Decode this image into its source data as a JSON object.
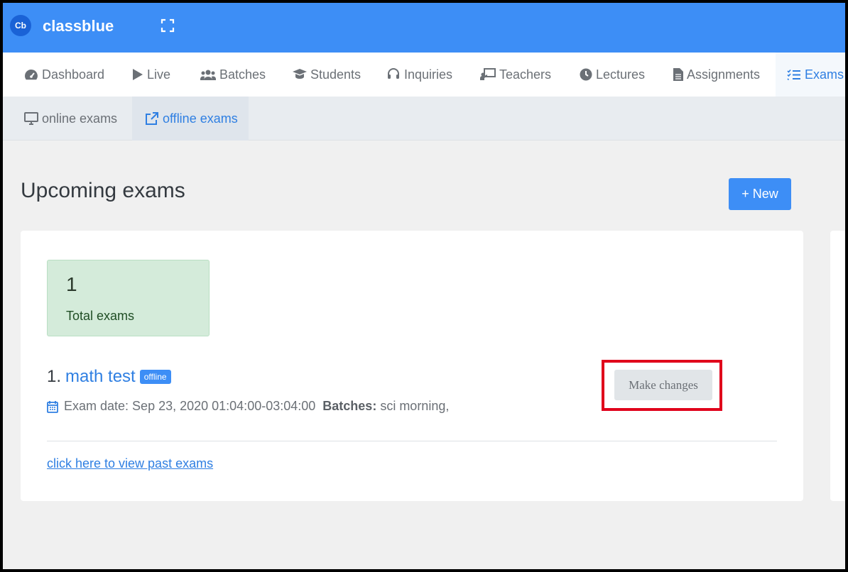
{
  "app": {
    "logo_text": "Cb",
    "name": "classblue"
  },
  "nav": {
    "items": [
      {
        "label": "Dashboard",
        "icon": "gauge-icon"
      },
      {
        "label": "Live",
        "icon": "play-icon"
      },
      {
        "label": "Batches",
        "icon": "users-icon"
      },
      {
        "label": "Students",
        "icon": "graduation-cap-icon"
      },
      {
        "label": "Inquiries",
        "icon": "headset-icon"
      },
      {
        "label": "Teachers",
        "icon": "chalkboard-teacher-icon"
      },
      {
        "label": "Lectures",
        "icon": "clock-icon"
      },
      {
        "label": "Assignments",
        "icon": "file-icon"
      },
      {
        "label": "Exams",
        "icon": "tasks-icon",
        "active": true
      }
    ]
  },
  "subnav": {
    "items": [
      {
        "label": "online exams",
        "icon": "desktop-icon"
      },
      {
        "label": "offline exams",
        "icon": "external-link-icon",
        "active": true
      }
    ]
  },
  "page": {
    "title": "Upcoming exams",
    "new_button": "+ New"
  },
  "stats": {
    "count": "1",
    "label": "Total exams"
  },
  "exams": [
    {
      "index": "1.",
      "name": "math test",
      "badge": "offline",
      "date_text": "Exam date: Sep 23, 2020 01:04:00-03:04:00",
      "batches_label": "Batches:",
      "batches_value": "sci morning,",
      "edit_button": "Make changes"
    }
  ],
  "past_link": "click here to view past exams",
  "colors": {
    "primary": "#3d8ef6",
    "highlight": "#e0001b",
    "stat_bg": "#d4ebda"
  }
}
